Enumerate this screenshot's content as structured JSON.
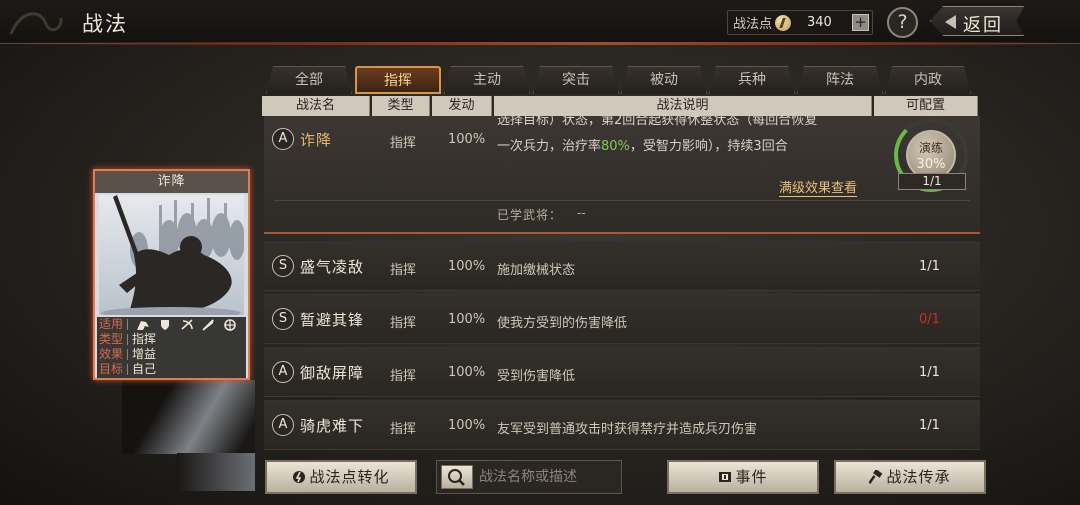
{
  "header": {
    "title": "战法",
    "points_label": "战法点",
    "points_value": "340",
    "plus_label": "+",
    "help_label": "?",
    "back_label": "返回"
  },
  "tabs": [
    {
      "label": "全部",
      "active": false
    },
    {
      "label": "指挥",
      "active": true
    },
    {
      "label": "主动",
      "active": false
    },
    {
      "label": "突击",
      "active": false
    },
    {
      "label": "被动",
      "active": false
    },
    {
      "label": "兵种",
      "active": false
    },
    {
      "label": "阵法",
      "active": false
    },
    {
      "label": "内政",
      "active": false
    }
  ],
  "columns": [
    "战法名",
    "类型",
    "发动",
    "战法说明",
    "可配置"
  ],
  "expanded": {
    "grade": "A",
    "name": "诈降",
    "type": "指挥",
    "rate": "100%",
    "desc_line1": "选择目标）状态，第2回合起获得休整状态（每回合恢复",
    "desc_line2_a": "一次兵力，治疗率",
    "desc_line2_pct": "80%",
    "desc_line2_b": "，受智力影响），持续3回合",
    "max_link": "满级效果查看",
    "learned_label": "已学武将：",
    "learned_value": "--",
    "train_label": "演练",
    "train_pct": "30%",
    "train_count": "1/1"
  },
  "rows": [
    {
      "grade": "S",
      "name": "盛气凌敌",
      "type": "指挥",
      "rate": "100%",
      "desc": "施加缴械状态",
      "count": "1/1",
      "red": false
    },
    {
      "grade": "S",
      "name": "暂避其锋",
      "type": "指挥",
      "rate": "100%",
      "desc": "使我方受到的伤害降低",
      "count": "0/1",
      "red": true
    },
    {
      "grade": "A",
      "name": "御敌屏障",
      "type": "指挥",
      "rate": "100%",
      "desc": "受到伤害降低",
      "count": "1/1",
      "red": false
    },
    {
      "grade": "A",
      "name": "骑虎难下",
      "type": "指挥",
      "rate": "100%",
      "desc": "友军受到普通攻击时获得禁疗并造成兵刃伤害",
      "count": "1/1",
      "red": false
    }
  ],
  "card": {
    "title": "诈降",
    "info": [
      {
        "key": "适用",
        "value": ""
      },
      {
        "key": "类型",
        "value": "指挥"
      },
      {
        "key": "效果",
        "value": "增益"
      },
      {
        "key": "目标",
        "value": "自己"
      }
    ]
  },
  "bottom": {
    "convert_label": "战法点转化",
    "search_placeholder": "战法名称或描述",
    "event_label": "事件",
    "inherit_label": "战法传承"
  },
  "colors": {
    "accent": "#e8b56a",
    "red_count": "#d42a22",
    "green": "#7ecb5a",
    "card_border": "#e07b52"
  }
}
